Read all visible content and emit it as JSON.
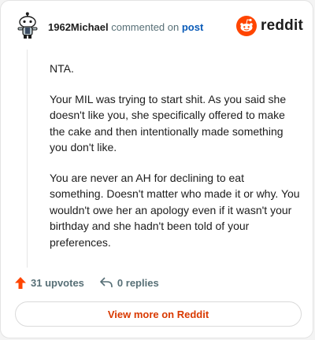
{
  "header": {
    "username": "1962Michael",
    "action_text": "commented on",
    "post_link": "post",
    "brand_name": "reddit",
    "brand_color": "#ff4500"
  },
  "comment": {
    "paragraphs": [
      "NTA.",
      "Your MIL was trying to start shit. As you said she doesn't like you, she specifically offered to make the cake and then intentionally made something you don't like.",
      "You are never an AH for declining to eat something. Doesn't matter who made it or why. You wouldn't owe her an apology even if it wasn't your birthday and she hadn't been told of your preferences."
    ]
  },
  "actions": {
    "upvotes": "31 upvotes",
    "upvote_icon": "upvote-arrow-icon",
    "replies": "0 replies",
    "reply_icon": "reply-arrow-icon"
  },
  "cta": {
    "label": "View more on Reddit"
  }
}
